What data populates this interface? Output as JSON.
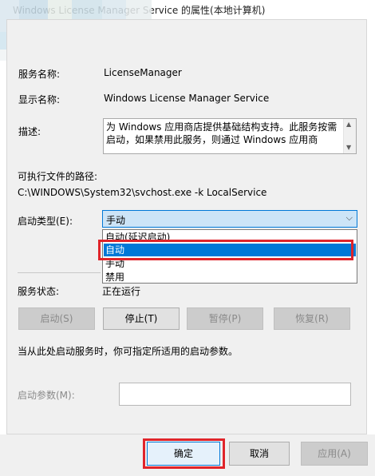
{
  "window": {
    "title": "Windows License Manager Service 的属性(本地计算机)"
  },
  "general": {
    "service_name_label": "服务名称:",
    "service_name": "LicenseManager",
    "display_name_label": "显示名称:",
    "display_name": "Windows License Manager Service",
    "description_label": "描述:",
    "description": "为 Windows 应用商店提供基础结构支持。此服务按需启动，如果禁用此服务，则通过 Windows 应用商",
    "path_label": "可执行文件的路径:",
    "path": "C:\\WINDOWS\\System32\\svchost.exe -k LocalService",
    "startup_type_label": "启动类型(E):",
    "startup_type_value": "手动",
    "startup_options": [
      "自动(延迟启动)",
      "自动",
      "手动",
      "禁用"
    ],
    "highlighted_option": "自动",
    "status_label": "服务状态:",
    "status_value": "正在运行",
    "hint": "当从此处启动服务时，你可指定所适用的启动参数。",
    "start_params_label": "启动参数(M):",
    "start_params_value": ""
  },
  "service_buttons": {
    "start": "启动(S)",
    "stop": "停止(T)",
    "pause": "暂停(P)",
    "resume": "恢复(R)"
  },
  "dialog_buttons": {
    "ok": "确定",
    "cancel": "取消",
    "apply": "应用(A)"
  },
  "colors": {
    "highlight_red": "#e0242a",
    "selection_blue": "#0078d7",
    "combo_focus_bg": "#cce4f7"
  }
}
